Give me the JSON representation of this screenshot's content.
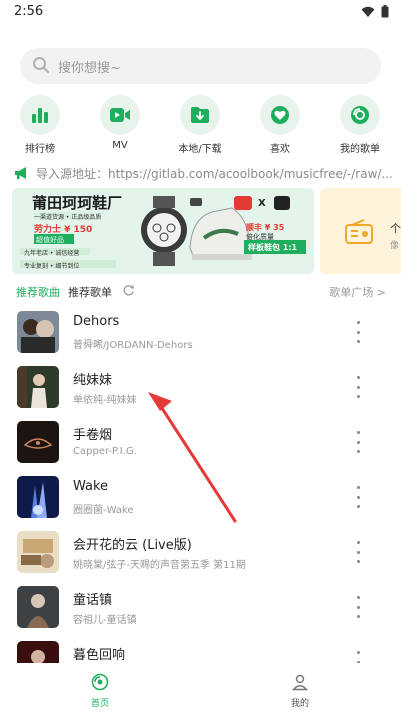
{
  "status_bar": {
    "time": "2:56"
  },
  "search": {
    "placeholder": "搜你想搜~"
  },
  "quick_actions": [
    {
      "label": "排行榜",
      "icon": "chart-bar-icon"
    },
    {
      "label": "MV",
      "icon": "video-icon"
    },
    {
      "label": "本地/下载",
      "icon": "download-folder-icon"
    },
    {
      "label": "喜欢",
      "icon": "heart-icon"
    },
    {
      "label": "我的歌单",
      "icon": "playlist-icon"
    }
  ],
  "notice": {
    "text": "导入源地址：https://gitlab.com/acoolbook/musicfree/-/raw/..."
  },
  "banner": {
    "headline": "莆田珂珂鞋厂",
    "lines": [
      "一渠道货源 • 正品级品质",
      "劳力士 ¥ 150",
      "超值好品",
      "九年老店 • 诚信经营",
      "专业复刻 • 细节到位"
    ],
    "right_lines": [
      "顺丰 ¥ 35",
      "倍化质量",
      "样板鞋包 1:1"
    ],
    "promo_x": "X"
  },
  "banner2": {
    "text": "个",
    "sub": "像"
  },
  "tabs": {
    "recommend_songs": "推荐歌曲",
    "recommend_playlists": "推荐歌单",
    "playlist_square": "歌单广场 >"
  },
  "songs": [
    {
      "title": "Dehors",
      "subtitle": "普舜晞/JORDANN-Dehors"
    },
    {
      "title": "纯妹妹",
      "subtitle": "单依纯-纯妹妹"
    },
    {
      "title": "手卷烟",
      "subtitle": "Capper-P.I.G."
    },
    {
      "title": "Wake",
      "subtitle": "圈圈菌-Wake"
    },
    {
      "title": "会开花的云 (Live版)",
      "subtitle": "姚晓棠/弦子-天赐的声音第五季 第11期"
    },
    {
      "title": "童话镇",
      "subtitle": "容祖儿-童话镇"
    },
    {
      "title": "暮色回响",
      "subtitle": ""
    }
  ],
  "bottom_nav": [
    {
      "label": "首页",
      "icon": "home-disc-icon",
      "active": true
    },
    {
      "label": "我的",
      "icon": "user-icon",
      "active": false
    }
  ],
  "colors": {
    "accent": "#1fae5e",
    "arrow": "#e53935"
  }
}
